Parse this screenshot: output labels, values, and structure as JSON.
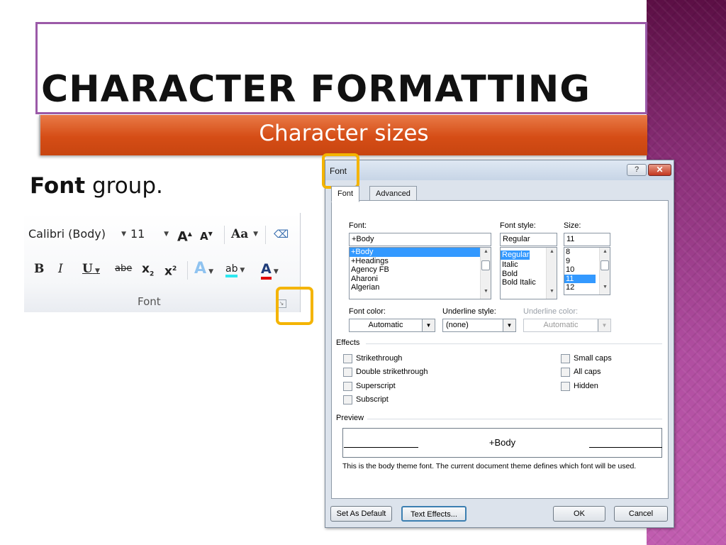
{
  "slide": {
    "title": "CHARACTER FORMATTING",
    "subtitle": "Character sizes",
    "body_bold": "Font",
    "body_rest": " group."
  },
  "ribbon": {
    "font_name": "Calibri (Body)",
    "font_size": "11",
    "grow_font": "A",
    "shrink_font": "A",
    "change_case": "Aa",
    "bold": "B",
    "italic": "I",
    "underline": "U",
    "strikethrough": "abe",
    "subscript": "x",
    "superscript": "x",
    "text_effects": "A",
    "highlight": "ab",
    "font_color": "A",
    "group_label": "Font"
  },
  "dialog": {
    "title": "Font",
    "help": "?",
    "close": "✕",
    "tabs": [
      "Font",
      "Advanced"
    ],
    "font_label": "Font:",
    "font_value": "+Body",
    "font_list": [
      "+Body",
      "+Headings",
      "Agency FB",
      "Aharoni",
      "Algerian"
    ],
    "font_selected": "+Body",
    "style_label": "Font style:",
    "style_value": "Regular",
    "style_list": [
      "Regular",
      "Italic",
      "Bold",
      "Bold Italic"
    ],
    "style_selected": "Regular",
    "size_label": "Size:",
    "size_value": "11",
    "size_list": [
      "8",
      "9",
      "10",
      "11",
      "12"
    ],
    "size_selected": "11",
    "font_color_label": "Font color:",
    "font_color_value": "Automatic",
    "underline_style_label": "Underline style:",
    "underline_style_value": "(none)",
    "underline_color_label": "Underline color:",
    "underline_color_value": "Automatic",
    "effects_label": "Effects",
    "effects_left": [
      "Strikethrough",
      "Double strikethrough",
      "Superscript",
      "Subscript"
    ],
    "effects_right": [
      "Small caps",
      "All caps",
      "Hidden"
    ],
    "preview_label": "Preview",
    "preview_text": "+Body",
    "preview_note": "This is the body theme font. The current document theme defines which font will be used.",
    "set_default": "Set As Default",
    "text_effects": "Text Effects...",
    "ok": "OK",
    "cancel": "Cancel"
  },
  "colors": {
    "title_border": "#9b5aa8",
    "subtitle_bar": "#d54d16",
    "highlight_ring": "#f4b400",
    "side_band": "#8a2f78"
  }
}
